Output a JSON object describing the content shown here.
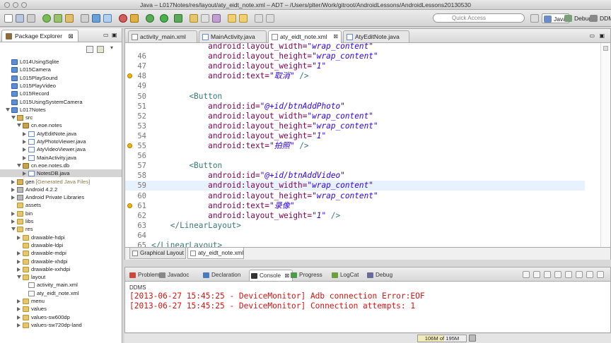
{
  "window": {
    "title": "Java – L017Notes/res/layout/aty_eidt_note.xml – ADT – /Users/plter/Work/gitroot/AndroidLessons/AndroidLessons20130530"
  },
  "toolbar": {
    "quick_access_placeholder": "Quick Access",
    "perspectives": [
      "Java",
      "Debug",
      "DDMS"
    ]
  },
  "package_explorer": {
    "title": "Package Explorer",
    "tree": [
      {
        "label": "L014UsingSqlite",
        "icon": "project-icon",
        "level": 0
      },
      {
        "label": "L015Camera",
        "icon": "project-icon",
        "level": 0
      },
      {
        "label": "L015PlaySound",
        "icon": "project-icon",
        "level": 0
      },
      {
        "label": "L015PlayVideo",
        "icon": "project-icon",
        "level": 0
      },
      {
        "label": "L015Record",
        "icon": "project-icon",
        "level": 0
      },
      {
        "label": "L015UsingSystemCamera",
        "icon": "project-icon",
        "level": 0
      },
      {
        "label": "L017Notes",
        "icon": "project-icon",
        "level": 0,
        "expanded": true
      },
      {
        "label": "src",
        "icon": "source-folder-icon",
        "level": 1,
        "expanded": true
      },
      {
        "label": "cn.eoe.notes",
        "icon": "package-icon",
        "level": 2,
        "expanded": true
      },
      {
        "label": "AtyEditNote.java",
        "icon": "java-file-icon",
        "level": 3,
        "expanded": false
      },
      {
        "label": "AtyPhotoViewer.java",
        "icon": "java-file-icon",
        "level": 3,
        "expanded": false
      },
      {
        "label": "AtyVideoViewer.java",
        "icon": "java-file-icon",
        "level": 3,
        "expanded": false
      },
      {
        "label": "MainActivity.java",
        "icon": "java-file-icon",
        "level": 3,
        "expanded": false
      },
      {
        "label": "cn.eoe.notes.db",
        "icon": "package-icon",
        "level": 2,
        "expanded": true
      },
      {
        "label": "NotesDB.java",
        "icon": "java-file-icon",
        "level": 3,
        "expanded": false,
        "selected": true
      },
      {
        "label": "gen [Generated Java Files]",
        "icon": "source-folder-icon",
        "level": 1,
        "expanded": false
      },
      {
        "label": "Android 4.2.2",
        "icon": "library-icon",
        "level": 1,
        "expanded": false
      },
      {
        "label": "Android Private Libraries",
        "icon": "library-icon",
        "level": 1,
        "expanded": false
      },
      {
        "label": "assets",
        "icon": "folder-icon",
        "level": 1
      },
      {
        "label": "bin",
        "icon": "folder-icon",
        "level": 1,
        "expanded": false
      },
      {
        "label": "libs",
        "icon": "folder-icon",
        "level": 1,
        "expanded": false
      },
      {
        "label": "res",
        "icon": "folder-icon",
        "level": 1,
        "expanded": true
      },
      {
        "label": "drawable-hdpi",
        "icon": "folder-icon",
        "level": 2,
        "expanded": false
      },
      {
        "label": "drawable-ldpi",
        "icon": "folder-icon",
        "level": 2
      },
      {
        "label": "drawable-mdpi",
        "icon": "folder-icon",
        "level": 2,
        "expanded": false
      },
      {
        "label": "drawable-xhdpi",
        "icon": "folder-icon",
        "level": 2,
        "expanded": false
      },
      {
        "label": "drawable-xxhdpi",
        "icon": "folder-icon",
        "level": 2,
        "expanded": false
      },
      {
        "label": "layout",
        "icon": "folder-icon",
        "level": 2,
        "expanded": true
      },
      {
        "label": "activity_main.xml",
        "icon": "xml-file-icon",
        "level": 3
      },
      {
        "label": "aty_eidt_note.xml",
        "icon": "xml-file-icon",
        "level": 3
      },
      {
        "label": "menu",
        "icon": "folder-icon",
        "level": 2,
        "expanded": false
      },
      {
        "label": "values",
        "icon": "folder-icon",
        "level": 2,
        "expanded": false
      },
      {
        "label": "values-sw600dp",
        "icon": "folder-icon",
        "level": 2,
        "expanded": false
      },
      {
        "label": "values-sw720dp-land",
        "icon": "folder-icon",
        "level": 2,
        "expanded": false
      }
    ]
  },
  "editor": {
    "tabs": [
      {
        "label": "activity_main.xml",
        "active": false
      },
      {
        "label": "MainActivity.java",
        "active": false
      },
      {
        "label": "aty_eidt_note.xml",
        "active": true
      },
      {
        "label": "AtyEditNote.java",
        "active": false
      }
    ],
    "lines": [
      {
        "num": "",
        "indent": "            ",
        "parts": [
          [
            "attr",
            "android:layout_width="
          ],
          [
            "val",
            "\"wrap_content\""
          ]
        ]
      },
      {
        "num": "46",
        "indent": "            ",
        "parts": [
          [
            "attr",
            "android:layout_height="
          ],
          [
            "val",
            "\"wrap_content\""
          ]
        ]
      },
      {
        "num": "47",
        "indent": "            ",
        "parts": [
          [
            "attr",
            "android:layout_weight="
          ],
          [
            "val",
            "\"1\""
          ]
        ]
      },
      {
        "num": "48",
        "indent": "            ",
        "parts": [
          [
            "attr",
            "android:text="
          ],
          [
            "val",
            "\"取消\""
          ],
          [
            "tag",
            " />"
          ]
        ],
        "warning": true
      },
      {
        "num": "49",
        "indent": "",
        "parts": []
      },
      {
        "num": "50",
        "indent": "        ",
        "parts": [
          [
            "tag",
            "<Button"
          ]
        ]
      },
      {
        "num": "51",
        "indent": "            ",
        "parts": [
          [
            "attr",
            "android:id="
          ],
          [
            "val",
            "\"@+id/btnAddPhoto\""
          ]
        ]
      },
      {
        "num": "52",
        "indent": "            ",
        "parts": [
          [
            "attr",
            "android:layout_width="
          ],
          [
            "val",
            "\"wrap_content\""
          ]
        ]
      },
      {
        "num": "53",
        "indent": "            ",
        "parts": [
          [
            "attr",
            "android:layout_height="
          ],
          [
            "val",
            "\"wrap_content\""
          ]
        ]
      },
      {
        "num": "54",
        "indent": "            ",
        "parts": [
          [
            "attr",
            "android:layout_weight="
          ],
          [
            "val",
            "\"1\""
          ]
        ]
      },
      {
        "num": "55",
        "indent": "            ",
        "parts": [
          [
            "attr",
            "android:text="
          ],
          [
            "val",
            "\"拍照\""
          ],
          [
            "tag",
            " />"
          ]
        ],
        "warning": true
      },
      {
        "num": "56",
        "indent": "",
        "parts": []
      },
      {
        "num": "57",
        "indent": "        ",
        "parts": [
          [
            "tag",
            "<Button"
          ]
        ]
      },
      {
        "num": "58",
        "indent": "            ",
        "parts": [
          [
            "attr",
            "android:id="
          ],
          [
            "val",
            "\"@+id/btnAddVideo\""
          ]
        ]
      },
      {
        "num": "59",
        "indent": "            ",
        "parts": [
          [
            "attr",
            "android:layout_width="
          ],
          [
            "val",
            "\"wrap_content\""
          ]
        ],
        "current": true
      },
      {
        "num": "60",
        "indent": "            ",
        "parts": [
          [
            "attr",
            "android:layout_height="
          ],
          [
            "val",
            "\"wrap_content\""
          ]
        ]
      },
      {
        "num": "61",
        "indent": "            ",
        "parts": [
          [
            "attr",
            "android:text="
          ],
          [
            "val",
            "\"录像\""
          ]
        ],
        "warning": true
      },
      {
        "num": "62",
        "indent": "            ",
        "parts": [
          [
            "attr",
            "android:layout_weight="
          ],
          [
            "val",
            "\"1\""
          ],
          [
            "tag",
            " />"
          ]
        ]
      },
      {
        "num": "63",
        "indent": "    ",
        "parts": [
          [
            "tag",
            "</LinearLayout>"
          ]
        ]
      },
      {
        "num": "64",
        "indent": "",
        "parts": []
      },
      {
        "num": "65",
        "indent": "",
        "parts": [
          [
            "tag",
            "</LinearLayout>"
          ]
        ]
      }
    ],
    "bottom_tabs": [
      {
        "label": "Graphical Layout",
        "active": false
      },
      {
        "label": "aty_eidt_note.xml",
        "active": true
      }
    ]
  },
  "console": {
    "tabs": [
      {
        "label": "Problems",
        "icon": "problems-icon",
        "color": "#c94a3a"
      },
      {
        "label": "Javadoc",
        "icon": "javadoc-icon",
        "color": "#888888"
      },
      {
        "label": "Declaration",
        "icon": "declaration-icon",
        "color": "#4b7bbf"
      },
      {
        "label": "Console",
        "icon": "console-icon",
        "color": "#333333",
        "active": true
      },
      {
        "label": "Progress",
        "icon": "progress-icon",
        "color": "#4b9b4b"
      },
      {
        "label": "LogCat",
        "icon": "logcat-icon",
        "color": "#6a9f3a"
      },
      {
        "label": "Debug",
        "icon": "debug-icon",
        "color": "#6b6b9b"
      }
    ],
    "label": "DDMS",
    "lines": [
      "[2013-06-27 15:45:25 - DeviceMonitor] Adb connection Error:EOF",
      "[2013-06-27 15:45:25 - DeviceMonitor] Connection attempts: 1"
    ]
  },
  "status": {
    "heap_text": "106M of 195M",
    "heap_used_fraction": 0.54
  },
  "colors": {
    "log_error": "#dd1111",
    "current_line": "#e8f2fe",
    "selection": "#d4d4d4"
  }
}
